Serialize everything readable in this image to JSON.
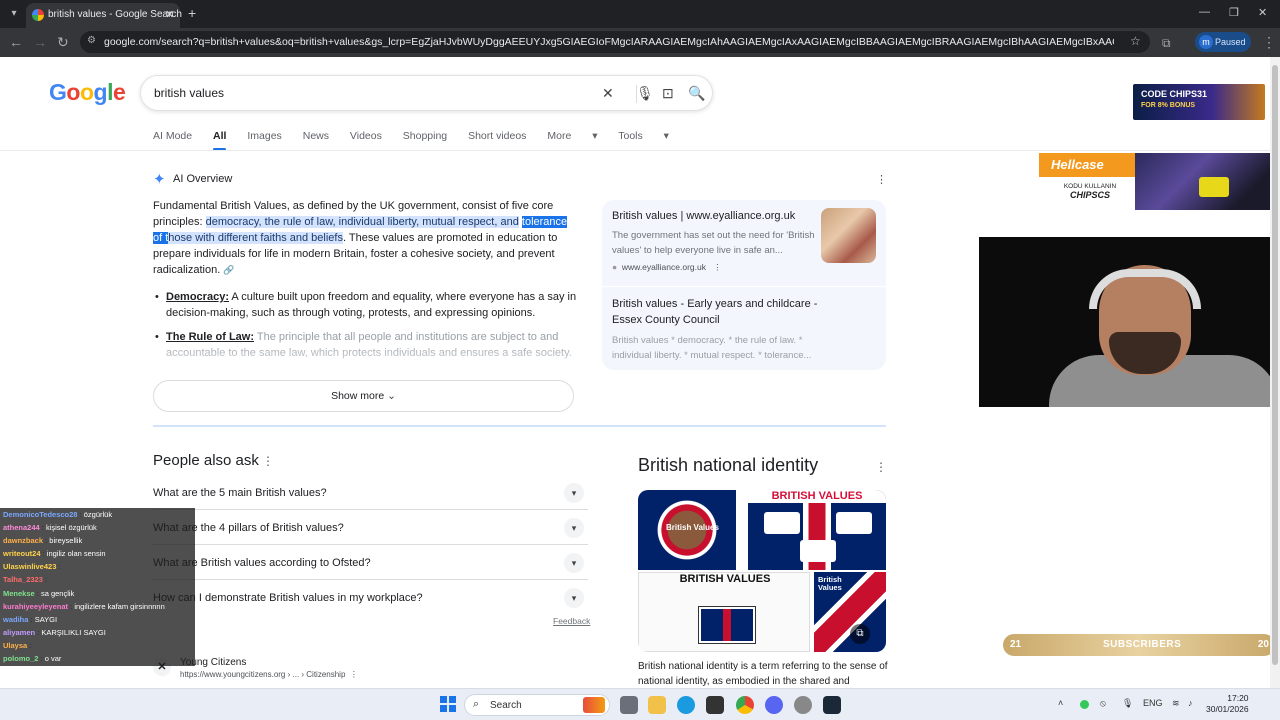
{
  "browser": {
    "tab_title": "british values - Google Search",
    "url": "google.com/search?q=british+values&oq=british+values&gs_lcrp=EgZjaHJvbWUyDggAEEUYJxg5GIAEGIoFMgcIARAAGIAEMgcIAhAAGIAEMgcIAxAAGIAEMgcIBBAAGIAEMgcIBRAAGIAEMgcIBhAAGIAEMgcIBxAAGIAEMgcICBAAGIAEMgcICRAAGIAEMgcICRAAGI8C...",
    "profile_initial": "m",
    "profile_status": "Paused"
  },
  "google": {
    "logo": "Google",
    "query": "british values",
    "tabs": [
      "AI Mode",
      "All",
      "Images",
      "News",
      "Videos",
      "Shopping",
      "Short videos",
      "More",
      "Tools"
    ],
    "selected_tab": "All"
  },
  "ai_overview": {
    "heading": "AI Overview",
    "intro_plain": "Fundamental British Values, as defined by the UK government, consist of five core principles: ",
    "intro_highlight": "democracy, the rule of law, individual liberty, mutual respect, and",
    "intro_highlight_sel": "tolerance of t",
    "intro_highlight_rest": "hose with different faiths and beliefs",
    "intro_end": ". These values are promoted in education to prepare individuals for life in modern Britain, foster a cohesive society, and prevent radicalization.",
    "bullets": [
      {
        "term": "Democracy:",
        "text": " A culture built upon freedom and equality, where everyone has a say in decision-making, such as through voting, protests, and expressing opinions."
      },
      {
        "term": "The Rule of Law:",
        "text": " The principle that all people and institutions are subject to and accountable to the same law, which protects individuals and ensures a safe society."
      }
    ],
    "show_more": "Show more",
    "sources": [
      {
        "title": "British values | www.eyalliance.org.uk",
        "snippet": "The government has set out the need for 'British values' to help everyone live in safe an...",
        "site": "www.eyalliance.org.uk"
      },
      {
        "title": "British values - Early years and childcare - Essex County Council",
        "snippet": "British values * democracy. * the rule of law. * individual liberty. * mutual respect. * tolerance..."
      }
    ]
  },
  "people_also_ask": {
    "heading": "People also ask",
    "questions": [
      "What are the 5 main British values?",
      "What are the 4 pillars of British values?",
      "What are British values according to Ofsted?",
      "How can I demonstrate British values in my workplace?"
    ],
    "feedback": "Feedback"
  },
  "result": {
    "site_name": "Young Citizens",
    "url": "https://www.youngcitizens.org › ... › Citizenship"
  },
  "knowledge_panel": {
    "title": "British national identity",
    "image_texts": [
      "British Values",
      "BRITISH VALUES",
      "BRITISH VALUES",
      "British Values"
    ],
    "description": "British national identity is a term referring to the sense of national identity, as embodied in the shared and"
  },
  "ads": {
    "ad1_line1": "CODE CHIPS31",
    "ad1_line2": "FOR 8% BONUS",
    "hellcase_brand": "Hellcase",
    "hellcase_line1": "KODU KULLANIN",
    "hellcase_code": "CHIPSCS"
  },
  "stream": {
    "sub_left": "21",
    "sub_label": "SUBSCRIBERS",
    "sub_right": "20",
    "chat": [
      {
        "name": "DemonicoTedesco28",
        "msg": "özgürlük",
        "color": "#7aa7ff"
      },
      {
        "name": "athena244",
        "msg": "kişisel özgürlük",
        "color": "#ff8ad8"
      },
      {
        "name": "dawnzback",
        "msg": "bireysellik",
        "color": "#ffb04a"
      },
      {
        "name": "writeout24",
        "msg": "ingiliz olan sensin",
        "color": "#ffd24a"
      },
      {
        "name": "Ulaswinlive423",
        "msg": "",
        "color": "#ffd24a"
      },
      {
        "name": "Talha_2323",
        "msg": "",
        "color": "#ff6b6b"
      },
      {
        "name": "Menekse",
        "msg": "sa gençlik",
        "color": "#7ee08a"
      },
      {
        "name": "kurahiyeeyleyenat",
        "msg": "ingilizlere kafam girsinnnnn",
        "color": "#ff7ad0"
      },
      {
        "name": "wadiha",
        "msg": "SAYGI",
        "color": "#7aa7ff"
      },
      {
        "name": "aliyamen",
        "msg": "KARŞILIKLI SAYGI",
        "color": "#c49aff"
      },
      {
        "name": "Ulaysa",
        "msg": "",
        "color": "#ffb04a"
      },
      {
        "name": "polomo_2",
        "msg": "o var",
        "color": "#7ee08a"
      }
    ]
  },
  "taskbar": {
    "search_label": "Search",
    "lang": "ENG",
    "time": "17:20",
    "date": "30/01/2026"
  },
  "icons": [
    "back-arrow-icon",
    "forward-arrow-icon",
    "reload-icon",
    "close-icon",
    "mic-icon",
    "lens-icon",
    "search-icon",
    "sparkle-icon",
    "chevron-down-icon",
    "windows-start-icon"
  ]
}
